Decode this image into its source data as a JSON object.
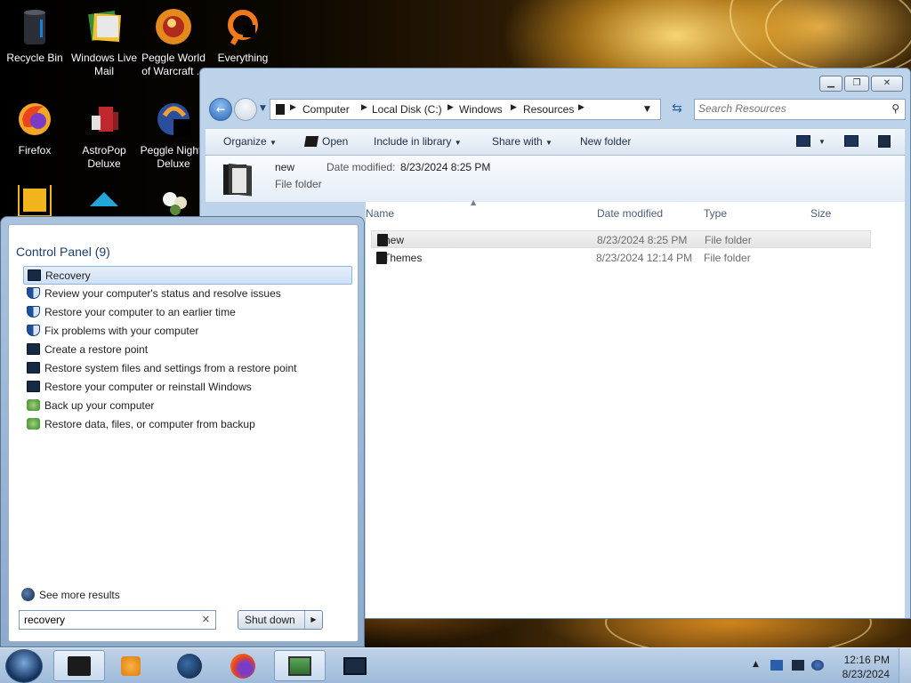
{
  "desktop": {
    "icons": [
      {
        "label": "Recycle Bin"
      },
      {
        "label": "Windows Live Mail"
      },
      {
        "label": "Peggle World of Warcraft ..."
      },
      {
        "label": "Everything"
      },
      {
        "label": "Firefox"
      },
      {
        "label": "AstroPop Deluxe"
      },
      {
        "label": "Peggle Nights Deluxe"
      }
    ]
  },
  "explorer": {
    "breadcrumb": [
      "Computer",
      "Local Disk (C:)",
      "Windows",
      "Resources"
    ],
    "search_placeholder": "Search Resources",
    "toolbar": {
      "organize": "Organize",
      "open": "Open",
      "include_in_library": "Include in library",
      "share_with": "Share with",
      "new_folder": "New folder"
    },
    "details_pane": {
      "name": "new",
      "modified_label": "Date modified:",
      "modified_value": "8/23/2024 8:25 PM",
      "type": "File folder"
    },
    "columns": {
      "name": "Name",
      "date_modified": "Date modified",
      "type": "Type",
      "size": "Size"
    },
    "files": [
      {
        "name": "new",
        "date": "8/23/2024 8:25 PM",
        "type": "File folder",
        "selected": true
      },
      {
        "name": "Themes",
        "date": "8/23/2024 12:14 PM",
        "type": "File folder",
        "selected": false
      }
    ]
  },
  "start_menu": {
    "group_title": "Control Panel (9)",
    "results": [
      {
        "label": "Recovery",
        "icon": "monitor-icon"
      },
      {
        "label": "Review your computer's status and resolve issues",
        "icon": "shield-icon"
      },
      {
        "label": "Restore your computer to an earlier time",
        "icon": "shield-icon"
      },
      {
        "label": "Fix problems with your computer",
        "icon": "shield-icon"
      },
      {
        "label": "Create a restore point",
        "icon": "monitor-icon"
      },
      {
        "label": "Restore system files and settings from a restore point",
        "icon": "monitor-icon"
      },
      {
        "label": "Restore your computer or reinstall Windows",
        "icon": "monitor-icon"
      },
      {
        "label": "Back up your computer",
        "icon": "backup-icon"
      },
      {
        "label": "Restore data, files, or computer from backup",
        "icon": "backup-icon"
      }
    ],
    "see_more": "See more results",
    "search_value": "recovery",
    "shutdown_label": "Shut down"
  },
  "taskbar": {
    "clock_time": "12:16 PM",
    "clock_date": "8/23/2024"
  }
}
